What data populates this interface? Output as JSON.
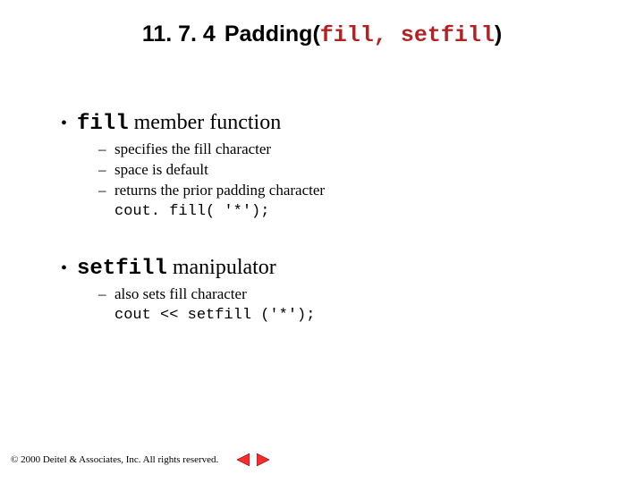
{
  "title": {
    "number": "11. 7. 4",
    "word": "Padding(",
    "code1": "fill",
    "sep": ", ",
    "code2": "setfill",
    "close": ")"
  },
  "content": {
    "b1": {
      "code": "fill",
      "text": " member function",
      "subs": [
        "specifies the fill character",
        "space is default",
        "returns the prior padding character"
      ],
      "code_line": "cout. fill( '*');"
    },
    "b2": {
      "code": "setfill",
      "text": " manipulator",
      "subs": [
        "also sets fill character"
      ],
      "code_line": "cout << setfill ('*');"
    }
  },
  "footer": {
    "copyright": "© 2000 Deitel & Associates, Inc.  All rights reserved."
  },
  "nav": {
    "prev": "previous-slide",
    "next": "next-slide"
  }
}
